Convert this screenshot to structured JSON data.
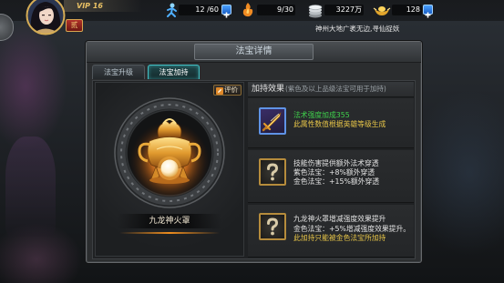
{
  "top_bar": {
    "vip": "VIP 16",
    "rank_badge": "贰",
    "stamina": "12 /60",
    "energy": "9/30",
    "coins": "3227万",
    "gold": "128",
    "marquee": "神州大地广袤无边,寻仙捉妖"
  },
  "panel": {
    "title": "法宝详情",
    "tabs": [
      {
        "label": "法宝升级",
        "active": false
      },
      {
        "label": "法宝加持",
        "active": true
      }
    ],
    "rate_button": "评价",
    "treasure_name": "九龙神火罩",
    "effects": {
      "heading": "加持效果",
      "note": "(紫色及以上品级法宝可用于加持)",
      "items": [
        {
          "icon": "sword-icon",
          "lines": [
            {
              "text": "法术强度加成355",
              "color": "#3fd24c"
            },
            {
              "text": "此属性数值根据英雄等级生成",
              "color": "#e7c548"
            }
          ]
        },
        {
          "icon": "question-mark-icon",
          "lines": [
            {
              "text": "技能伤害提供额外法术穿透",
              "color": "#e4e4e4"
            },
            {
              "text": "紫色法宝：+8%额外穿透",
              "color": "#e4e4e4"
            },
            {
              "text": "金色法宝：+15%额外穿透",
              "color": "#e4e4e4"
            }
          ]
        },
        {
          "icon": "question-mark-icon",
          "lines": [
            {
              "text": "九龙神火罩增减强度效果提升",
              "color": "#e4e4e4"
            },
            {
              "text": "金色法宝：+5%增减强度效果提升。",
              "color": "#e4e4e4"
            },
            {
              "text": "此加持只能被金色法宝所加持",
              "color": "#e7c548"
            }
          ]
        }
      ]
    }
  },
  "icons": {
    "stamina": "stamina-icon",
    "energy": "energy-icon",
    "coins": "coin-icon",
    "gold": "gold-ingot-icon",
    "add": "plus-icon",
    "rate": "pencil-icon",
    "treasure": "cauldron-icon"
  },
  "colors": {
    "tab_active": "#43c0c4",
    "gold_accent": "#e0a23a",
    "panel_bg": "#2b2d2f"
  }
}
